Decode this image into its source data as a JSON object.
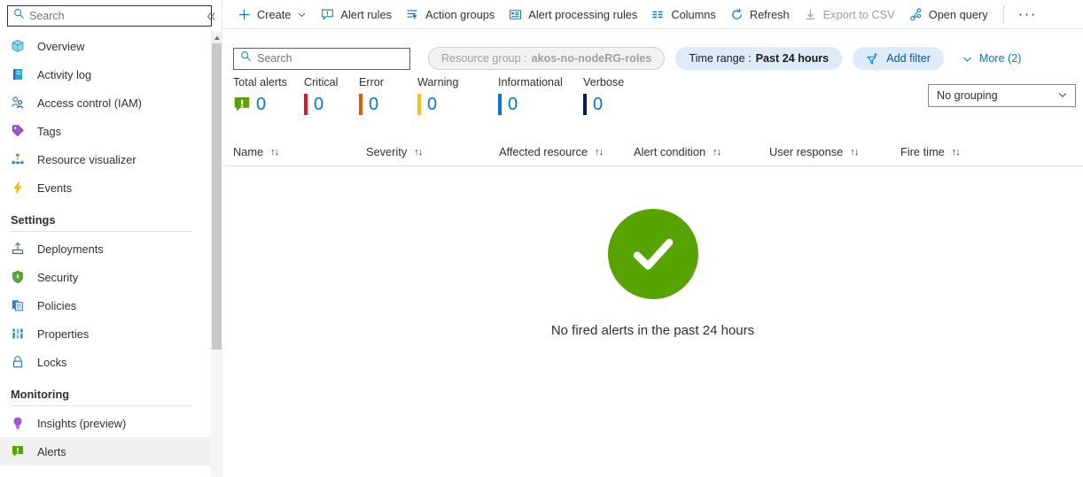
{
  "sidebar": {
    "search": {
      "placeholder": "Search",
      "value": ""
    },
    "collapse_label": "«",
    "items": [
      {
        "label": "Overview",
        "icon": "cube-icon"
      },
      {
        "label": "Activity log",
        "icon": "activity-log-icon"
      },
      {
        "label": "Access control (IAM)",
        "icon": "people-icon"
      },
      {
        "label": "Tags",
        "icon": "tag-icon"
      },
      {
        "label": "Resource visualizer",
        "icon": "network-icon"
      },
      {
        "label": "Events",
        "icon": "lightning-icon"
      }
    ],
    "settings_group": "Settings",
    "settings_items": [
      {
        "label": "Deployments",
        "icon": "deployments-icon"
      },
      {
        "label": "Security",
        "icon": "shield-icon"
      },
      {
        "label": "Policies",
        "icon": "policies-icon"
      },
      {
        "label": "Properties",
        "icon": "properties-icon"
      },
      {
        "label": "Locks",
        "icon": "lock-icon"
      }
    ],
    "monitoring_group": "Monitoring",
    "monitoring_items": [
      {
        "label": "Insights (preview)",
        "icon": "lightbulb-icon",
        "selected": false
      },
      {
        "label": "Alerts",
        "icon": "alerts-icon",
        "selected": true
      }
    ]
  },
  "toolbar": {
    "create_label": "Create",
    "alert_rules_label": "Alert rules",
    "action_groups_label": "Action groups",
    "alert_processing_rules_label": "Alert processing rules",
    "columns_label": "Columns",
    "refresh_label": "Refresh",
    "export_csv_label": "Export to CSV",
    "open_query_label": "Open query",
    "more_label": "···"
  },
  "filters": {
    "search": {
      "placeholder": "Search",
      "value": ""
    },
    "resource_group": {
      "key": "Resource group :",
      "value": "akos-no-nodeRG-roles",
      "disabled": true
    },
    "time_range": {
      "key": "Time range :",
      "value": "Past 24 hours"
    },
    "add_filter_label": "Add filter",
    "more_label": "More (2)"
  },
  "summary": {
    "grouping_value": "No grouping",
    "cells": [
      {
        "label": "Total alerts",
        "value": "0",
        "color": "#57a300",
        "kind": "total"
      },
      {
        "label": "Critical",
        "value": "0",
        "color": "#e81123",
        "kind": "bar"
      },
      {
        "label": "Error",
        "value": "0",
        "color": "#e55a00",
        "kind": "bar"
      },
      {
        "label": "Warning",
        "value": "0",
        "color": "#ffc20e",
        "kind": "bar"
      },
      {
        "label": "Informational",
        "value": "0",
        "color": "#0078d4",
        "kind": "bar"
      },
      {
        "label": "Verbose",
        "value": "0",
        "color": "#002050",
        "kind": "bar"
      }
    ]
  },
  "table": {
    "columns": [
      {
        "label": "Name",
        "sort": "↑↓"
      },
      {
        "label": "Severity",
        "sort": "↑↓"
      },
      {
        "label": "Affected resource",
        "sort": "↑↓"
      },
      {
        "label": "Alert condition",
        "sort": "↑↓"
      },
      {
        "label": "User response",
        "sort": "↑↓"
      },
      {
        "label": "Fire time",
        "sort": "↑↓"
      }
    ],
    "empty_message": "No fired alerts in the past 24 hours",
    "empty_icon_color": "#57a300"
  },
  "colors": {
    "accent": "#0078d4",
    "pill_active_bg": "#deecf9",
    "selected_row_bg": "#f0f0f0"
  }
}
